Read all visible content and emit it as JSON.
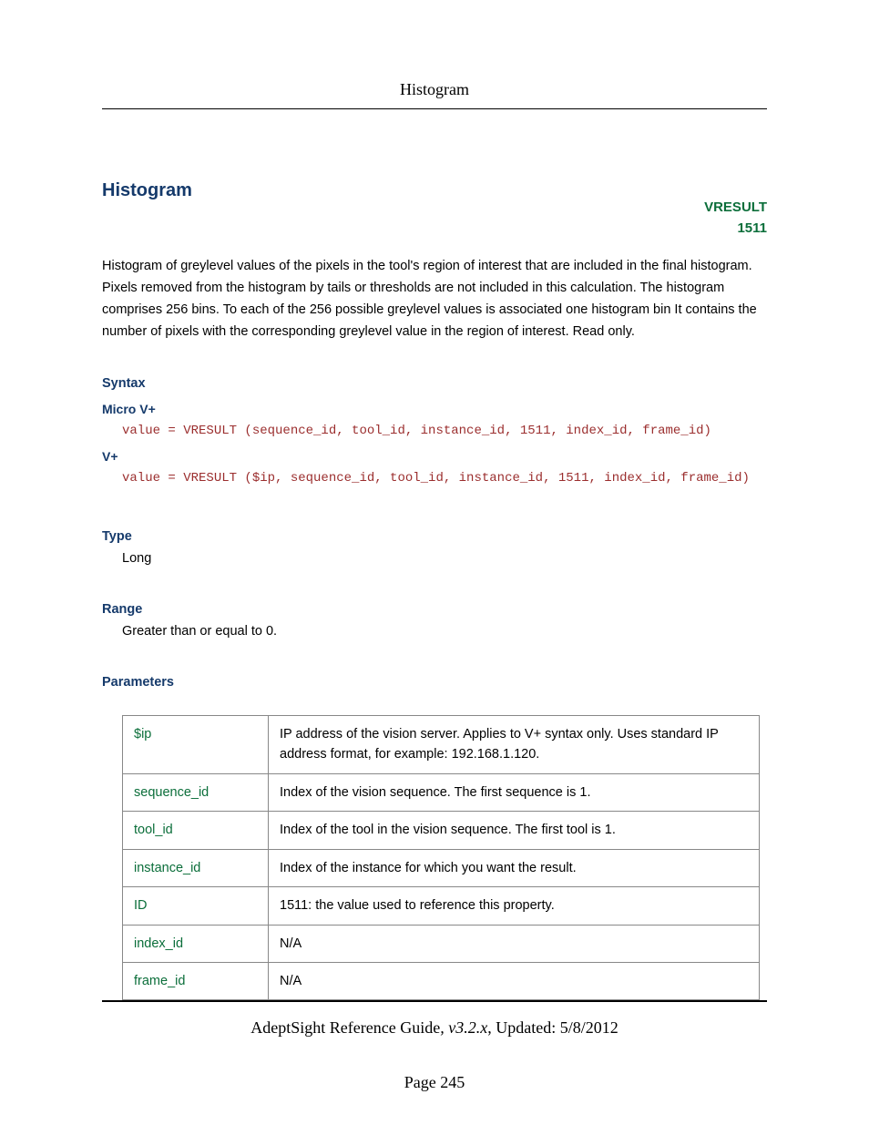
{
  "header": {
    "running_title": "Histogram"
  },
  "title": "Histogram",
  "tag": {
    "line1": "VRESULT",
    "line2": "1511"
  },
  "description": "Histogram of greylevel values of the pixels in the tool's region of interest that are included in the final histogram. Pixels removed from the histogram by tails or thresholds are not included in this calculation. The histogram comprises 256 bins. To each of the 256 possible greylevel values is associated one histogram bin It contains the number of pixels with the corresponding greylevel value in the region of interest. Read only.",
  "syntax": {
    "heading": "Syntax",
    "micro_label": "Micro V+",
    "micro_code": "value = VRESULT (sequence_id, tool_id, instance_id, 1511, index_id, frame_id)",
    "vplus_label": "V+",
    "vplus_code": "value = VRESULT ($ip, sequence_id, tool_id, instance_id, 1511, index_id, frame_id)"
  },
  "type_section": {
    "heading": "Type",
    "value": "Long"
  },
  "range_section": {
    "heading": "Range",
    "value": "Greater than or equal to 0."
  },
  "parameters": {
    "heading": "Parameters",
    "rows": [
      {
        "name": "$ip",
        "desc": "IP address of the vision server. Applies to V+ syntax only. Uses standard IP address format, for example: 192.168.1.120."
      },
      {
        "name": "sequence_id",
        "desc": "Index of the vision sequence. The first sequence is 1."
      },
      {
        "name": "tool_id",
        "desc": "Index of the tool in the vision sequence. The first tool is 1."
      },
      {
        "name": "instance_id",
        "desc": "Index of the instance for which you want the result."
      },
      {
        "name": "ID",
        "desc": "1511: the value used to reference this property."
      },
      {
        "name": "index_id",
        "desc": "N/A"
      },
      {
        "name": "frame_id",
        "desc": "N/A"
      }
    ]
  },
  "footer": {
    "doc_title": "AdeptSight Reference Guide",
    "version": ", v3.2.x",
    "updated": ", Updated: 5/8/2012",
    "page": "Page 245"
  }
}
